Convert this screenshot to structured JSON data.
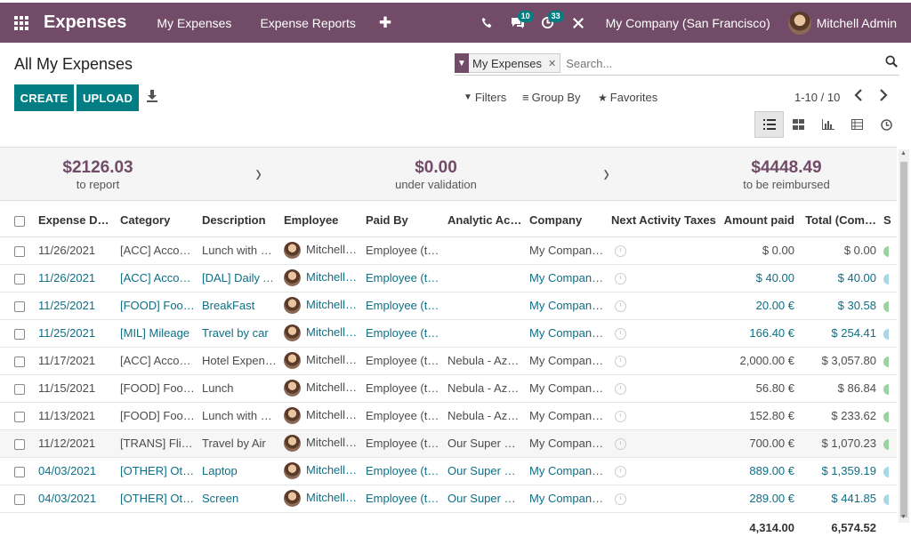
{
  "navbar": {
    "app_name": "Expenses",
    "menus": [
      "My Expenses",
      "Expense Reports"
    ],
    "plus": "✚",
    "chat_badge": "10",
    "activity_badge": "33",
    "company": "My Company (San Francisco)",
    "user": "Mitchell Admin"
  },
  "page": {
    "title": "All My Expenses",
    "create_label": "CREATE",
    "upload_label": "UPLOAD"
  },
  "search": {
    "facet": "My Expenses",
    "placeholder": "Search..."
  },
  "filters": {
    "filters_label": "Filters",
    "groupby_label": "Group By",
    "favorites_label": "Favorites"
  },
  "pager": {
    "value": "1-10 / 10"
  },
  "summary": [
    {
      "amount": "$2126.03",
      "label": "to report"
    },
    {
      "amount": "$0.00",
      "label": "under validation"
    },
    {
      "amount": "$4448.49",
      "label": "to be reimbursed"
    }
  ],
  "table": {
    "headers": [
      "Expense D…",
      "Category",
      "Description",
      "Employee",
      "Paid By",
      "Analytic Ac…",
      "Company",
      "Next Activity",
      "Taxes",
      "Amount paid",
      "Total (Com…",
      "S"
    ],
    "rows": [
      {
        "date": "11/26/2021",
        "category": "[ACC] Acco…",
        "description": "Lunch with C…",
        "employee": "Mitchell Ad",
        "paid_by": "Employee (t…",
        "analytic": "",
        "company": "My Compan…",
        "taxes": "",
        "amount": "$ 0.00",
        "total": "$ 0.00",
        "link": false,
        "status": "#9bd3a0"
      },
      {
        "date": "11/26/2021",
        "category": "[ACC] Acco…",
        "description": "[DAL] Daily A…",
        "employee": "Mitchell Ad",
        "paid_by": "Employee (t…",
        "analytic": "",
        "company": "My Compan…",
        "taxes": "",
        "amount": "$ 40.00",
        "total": "$ 40.00",
        "link": true,
        "status": "#a8d8e8"
      },
      {
        "date": "11/25/2021",
        "category": "[FOOD] Food…",
        "description": "BreakFast",
        "employee": "Mitchell Ad",
        "paid_by": "Employee (t…",
        "analytic": "",
        "company": "My Compan…",
        "taxes": "",
        "amount": "20.00 €",
        "total": "$ 30.58",
        "link": true,
        "status": "#9bd3a0"
      },
      {
        "date": "11/25/2021",
        "category": "[MIL] Mileage",
        "description": "Travel by car",
        "employee": "Mitchell Ad",
        "paid_by": "Employee (t…",
        "analytic": "",
        "company": "My Compan…",
        "taxes": "",
        "amount": "166.40 €",
        "total": "$ 254.41",
        "link": true,
        "status": "#a8d8e8"
      },
      {
        "date": "11/17/2021",
        "category": "[ACC] Acco…",
        "description": "Hotel Expen…",
        "employee": "Mitchell Ad",
        "paid_by": "Employee (t…",
        "analytic": "Nebula - Azu…",
        "company": "My Compan…",
        "taxes": "",
        "amount": "2,000.00 €",
        "total": "$ 3,057.80",
        "link": false,
        "status": "#9bd3a0"
      },
      {
        "date": "11/15/2021",
        "category": "[FOOD] Food…",
        "description": "Lunch",
        "employee": "Mitchell Ad",
        "paid_by": "Employee (t…",
        "analytic": "Nebula - Azu…",
        "company": "My Compan…",
        "taxes": "",
        "amount": "56.80 €",
        "total": "$ 86.84",
        "link": false,
        "status": "#9bd3a0"
      },
      {
        "date": "11/13/2021",
        "category": "[FOOD] Food…",
        "description": "Lunch with C…",
        "employee": "Mitchell Ad",
        "paid_by": "Employee (t…",
        "analytic": "Nebula - Azu…",
        "company": "My Compan…",
        "taxes": "",
        "amount": "152.80 €",
        "total": "$ 233.62",
        "link": false,
        "status": "#9bd3a0"
      },
      {
        "date": "11/12/2021",
        "category": "[TRANS] Flig…",
        "description": "Travel by Air",
        "employee": "Mitchell Ad",
        "paid_by": "Employee (t…",
        "analytic": "Our Super Pr…",
        "company": "My Compan…",
        "taxes": "",
        "amount": "700.00 €",
        "total": "$ 1,070.23",
        "link": false,
        "status": "#9bd3a0",
        "selected": true
      },
      {
        "date": "04/03/2021",
        "category": "[OTHER] Oth…",
        "description": "Laptop",
        "employee": "Mitchell Ad",
        "paid_by": "Employee (t…",
        "analytic": "Our Super Pr…",
        "company": "My Compan…",
        "taxes": "",
        "amount": "889.00 €",
        "total": "$ 1,359.19",
        "link": true,
        "status": "#a8d8e8"
      },
      {
        "date": "04/03/2021",
        "category": "[OTHER] Oth…",
        "description": "Screen",
        "employee": "Mitchell Ad",
        "paid_by": "Employee (t…",
        "analytic": "Our Super Pr…",
        "company": "My Compan…",
        "taxes": "",
        "amount": "289.00 €",
        "total": "$ 441.85",
        "link": true,
        "status": "#a8d8e8"
      }
    ],
    "totals": {
      "amount": "4,314.00",
      "total": "6,574.52"
    }
  }
}
